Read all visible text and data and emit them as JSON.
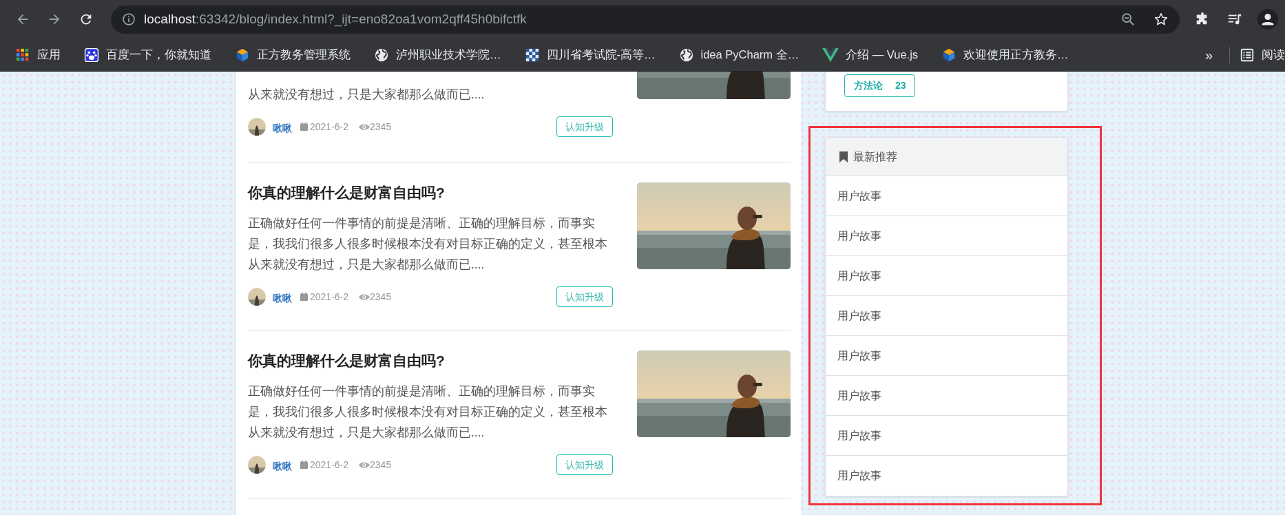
{
  "browser": {
    "url": {
      "host": "localhost",
      "path": ":63342/blog/index.html?_ijt=eno82oa1vom2qff45h0bifctfk"
    },
    "bookmarks": [
      {
        "kind": "apps",
        "label": "应用"
      },
      {
        "kind": "baidu",
        "label": "百度一下，你就知道"
      },
      {
        "kind": "cube",
        "label": "正方教务管理系统"
      },
      {
        "kind": "globe",
        "label": "泸州职业技术学院…"
      },
      {
        "kind": "mosaic",
        "label": "四川省考试院-高等…"
      },
      {
        "kind": "globe",
        "label": "idea PyCharm 全…"
      },
      {
        "kind": "vue",
        "label": "介绍 — Vue.js"
      },
      {
        "kind": "cube",
        "label": "欢迎使用正方教务…"
      }
    ],
    "more": "»",
    "reading_list": "阅读"
  },
  "articles": [
    {
      "kind": "cut",
      "excerpt": "从来就没有想过，只是大家都那么做而已....",
      "author": "啾啾",
      "date": "2021-6-2",
      "views": "2345",
      "tag": "认知升级"
    },
    {
      "kind": "full",
      "title": "你真的理解什么是财富自由吗?",
      "excerpt": "正确做好任何一件事情的前提是清晰、正确的理解目标，而事实是，我我们很多人很多时候根本没有对目标正确的定义，甚至根本从来就没有想过，只是大家都那么做而已....",
      "author": "啾啾",
      "date": "2021-6-2",
      "views": "2345",
      "tag": "认知升级"
    },
    {
      "kind": "full",
      "title": "你真的理解什么是财富自由吗?",
      "excerpt": "正确做好任何一件事情的前提是清晰、正确的理解目标，而事实是，我我们很多人很多时候根本没有对目标正确的定义，甚至根本从来就没有想过，只是大家都那么做而已....",
      "author": "啾啾",
      "date": "2021-6-2",
      "views": "2345",
      "tag": "认知升级"
    }
  ],
  "sidebar": {
    "tags": [
      {
        "label": "方法论",
        "count": "23"
      }
    ],
    "recommend": {
      "title": "最新推荐",
      "items": [
        "用户故事",
        "用户故事",
        "用户故事",
        "用户故事",
        "用户故事",
        "用户故事",
        "用户故事",
        "用户故事"
      ]
    }
  }
}
